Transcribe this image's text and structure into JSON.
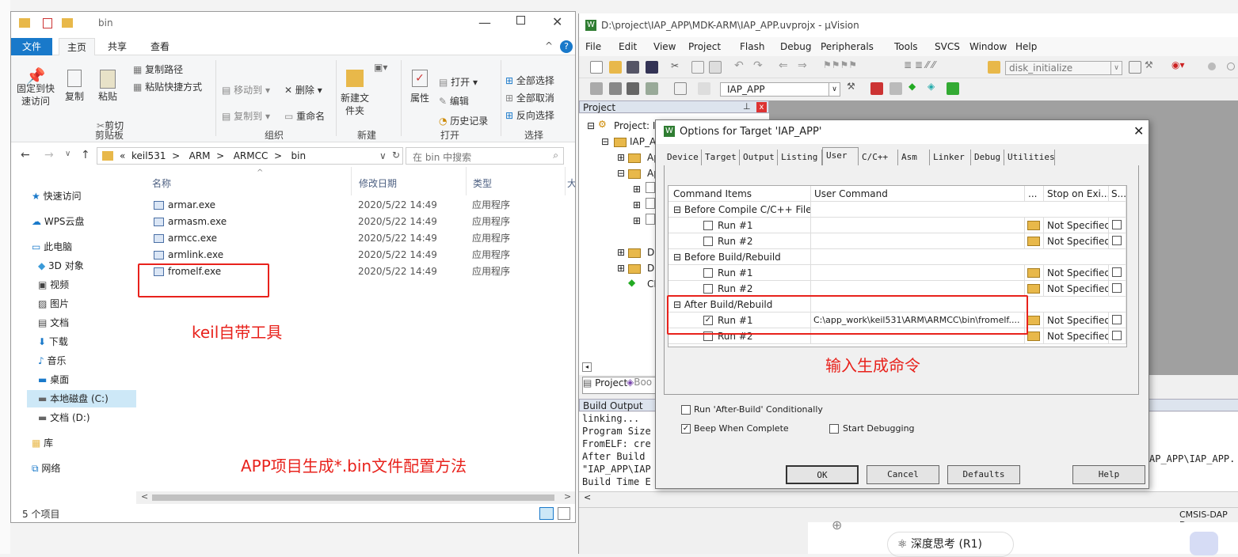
{
  "explorer": {
    "title": "bin",
    "tabs": [
      "文件",
      "主页",
      "共享",
      "查看"
    ],
    "ribbon": {
      "pin": "固定到快速访问",
      "copy": "复制",
      "paste": "粘贴",
      "copy_path": "复制路径",
      "paste_shortcut": "粘贴快捷方式",
      "cut": "剪切",
      "move_to": "移动到",
      "copy_to": "复制到",
      "delete": "删除",
      "rename": "重命名",
      "new_folder": "新建文件夹",
      "properties": "属性",
      "open": "打开",
      "edit": "编辑",
      "history": "历史记录",
      "select_all": "全部选择",
      "select_none": "全部取消",
      "invert": "反向选择",
      "groups": [
        "剪贴板",
        "组织",
        "新建",
        "打开",
        "选择"
      ]
    },
    "breadcrumb": [
      "«",
      "keil531",
      ">",
      "ARM",
      ">",
      "ARMCC",
      ">",
      "bin"
    ],
    "search_placeholder": "在 bin 中搜索",
    "nav": [
      "快速访问",
      "WPS云盘",
      "此电脑",
      "3D 对象",
      "视频",
      "图片",
      "文档",
      "下载",
      "音乐",
      "桌面",
      "本地磁盘 (C:)",
      "文档 (D:)",
      "库",
      "网络"
    ],
    "columns": [
      "名称",
      "修改日期",
      "类型",
      "大"
    ],
    "files": [
      {
        "name": "armar.exe",
        "date": "2020/5/22 14:49",
        "type": "应用程序"
      },
      {
        "name": "armasm.exe",
        "date": "2020/5/22 14:49",
        "type": "应用程序"
      },
      {
        "name": "armcc.exe",
        "date": "2020/5/22 14:49",
        "type": "应用程序"
      },
      {
        "name": "armlink.exe",
        "date": "2020/5/22 14:49",
        "type": "应用程序"
      },
      {
        "name": "fromelf.exe",
        "date": "2020/5/22 14:49",
        "type": "应用程序"
      }
    ],
    "status": "5 个项目",
    "annot1": "keil自带工具",
    "annot2": "APP项目生成*.bin文件配置方法"
  },
  "uv": {
    "title": "D:\\project\\IAP_APP\\MDK-ARM\\IAP_APP.uvprojx - µVision",
    "menu": [
      "File",
      "Edit",
      "View",
      "Project",
      "Flash",
      "Debug",
      "Peripherals",
      "Tools",
      "SVCS",
      "Window",
      "Help"
    ],
    "func_combo": "disk_initialize",
    "target_combo": "IAP_APP",
    "project_panel": "Project",
    "tree": [
      "Project: IA",
      "IAP_A",
      "Ap",
      "Ap",
      "Dr",
      "Dr",
      "CN"
    ],
    "panel_tabs": [
      "Project",
      "Boo"
    ],
    "build_output_title": "Build Output",
    "build_lines": [
      "linking...",
      "Program Size",
      "FromELF: cre",
      "After Build ",
      "\"IAP_APP\\IAP",
      "Build Time E"
    ],
    "build_tail": "AP_APP\\IAP_APP.",
    "status_right": "CMSIS-DAP De"
  },
  "dialog": {
    "title": "Options for Target 'IAP_APP'",
    "tabs": [
      "Device",
      "Target",
      "Output",
      "Listing",
      "User",
      "C/C++",
      "Asm",
      "Linker",
      "Debug",
      "Utilities"
    ],
    "headers": [
      "Command Items",
      "User Command",
      "...",
      "Stop on Exi...",
      "S..."
    ],
    "rows": [
      {
        "label": "Before Compile C/C++ File",
        "kind": "group"
      },
      {
        "label": "Run #1",
        "kind": "item",
        "checked": false,
        "cmd": "",
        "stop": "Not Specified"
      },
      {
        "label": "Run #2",
        "kind": "item",
        "checked": false,
        "cmd": "",
        "stop": "Not Specified"
      },
      {
        "label": "Before Build/Rebuild",
        "kind": "group"
      },
      {
        "label": "Run #1",
        "kind": "item",
        "checked": false,
        "cmd": "",
        "stop": "Not Specified"
      },
      {
        "label": "Run #2",
        "kind": "item",
        "checked": false,
        "cmd": "",
        "stop": "Not Specified"
      },
      {
        "label": "After Build/Rebuild",
        "kind": "group"
      },
      {
        "label": "Run #1",
        "kind": "item",
        "checked": true,
        "cmd": "C:\\app_work\\keil531\\ARM\\ARMCC\\bin\\fromelf....",
        "stop": "Not Specified"
      },
      {
        "label": "Run #2",
        "kind": "item",
        "checked": false,
        "cmd": "",
        "stop": "Not Specified"
      }
    ],
    "opt_run_after": "Run 'After-Build' Conditionally",
    "opt_beep": "Beep When Complete",
    "opt_start_debug": "Start Debugging",
    "buttons": [
      "OK",
      "Cancel",
      "Defaults",
      "Help"
    ],
    "annot": "输入生成命令"
  },
  "bottom": {
    "deep_think": "深度思考 (R1)"
  },
  "colors": {
    "accent": "#0063b1",
    "red": "#e8221c"
  }
}
